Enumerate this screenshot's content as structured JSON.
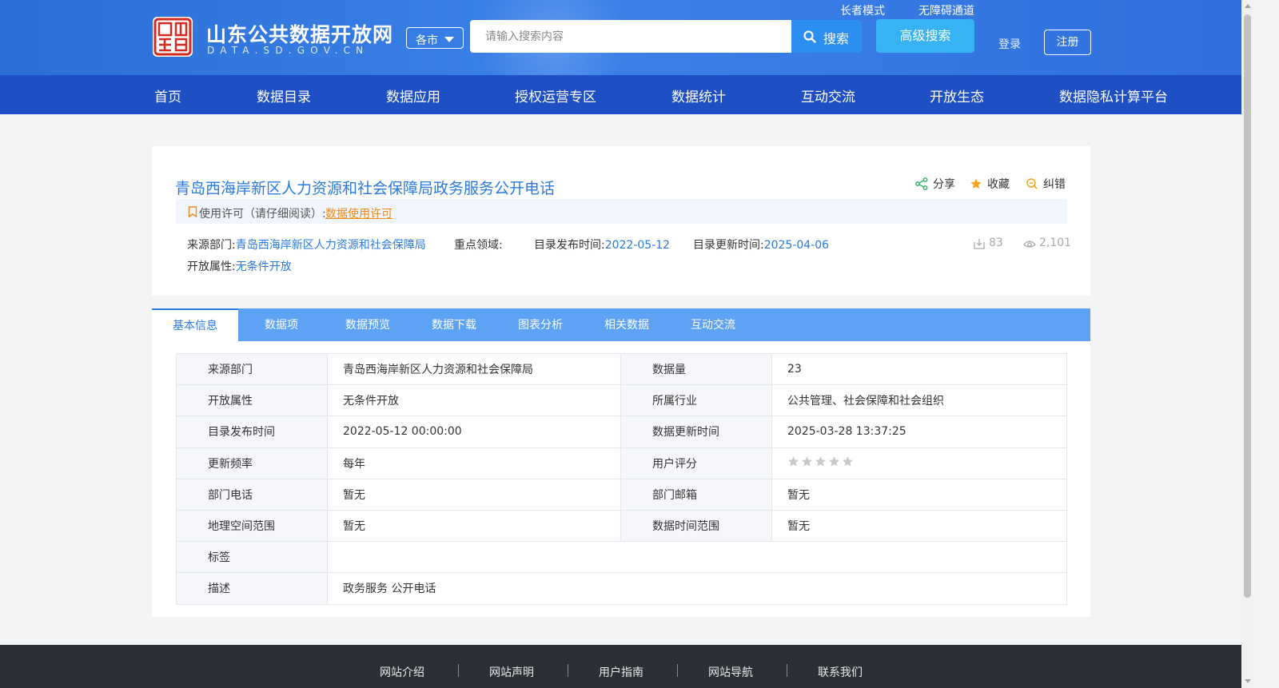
{
  "header": {
    "site_title": "山东公共数据开放网",
    "site_subtitle": "DATA.SD.GOV.CN",
    "city_select": "各市",
    "search_placeholder": "请输入搜索内容",
    "search_button": "搜索",
    "advanced_search": "高级搜索",
    "elder_mode": "长者模式",
    "accessibility": "无障碍通道",
    "login": "登录",
    "register": "注册"
  },
  "nav": {
    "items": [
      "首页",
      "数据目录",
      "数据应用",
      "授权运营专区",
      "数据统计",
      "互动交流",
      "开放生态",
      "数据隐私计算平台"
    ]
  },
  "dataset": {
    "title": "青岛西海岸新区人力资源和社会保障局政务服务公开电话",
    "actions": {
      "share": "分享",
      "favorite": "收藏",
      "report": "纠错"
    },
    "license_label": "使用许可（请仔细阅读）:",
    "license_link": "数据使用许可",
    "source_label": "来源部门:",
    "source_value": "青岛西海岸新区人力资源和社会保障局",
    "domain_label": "重点领域:",
    "domain_value": "",
    "publish_label": "目录发布时间:",
    "publish_value": "2022-05-12",
    "update_label": "目录更新时间:",
    "update_value": "2025-04-06",
    "open_label": "开放属性:",
    "open_value": "无条件开放",
    "downloads": "83",
    "views": "2,101"
  },
  "tabs": [
    "基本信息",
    "数据项",
    "数据预览",
    "数据下载",
    "图表分析",
    "相关数据",
    "互动交流"
  ],
  "info_table": {
    "rows": [
      {
        "k1": "来源部门",
        "v1": "青岛西海岸新区人力资源和社会保障局",
        "k2": "数据量",
        "v2": "23"
      },
      {
        "k1": "开放属性",
        "v1": "无条件开放",
        "k2": "所属行业",
        "v2": "公共管理、社会保障和社会组织"
      },
      {
        "k1": "目录发布时间",
        "v1": "2022-05-12 00:00:00",
        "k2": "数据更新时间",
        "v2": "2025-03-28 13:37:25"
      },
      {
        "k1": "更新频率",
        "v1": "每年",
        "k2": "用户评分",
        "v2": ""
      },
      {
        "k1": "部门电话",
        "v1": "暂无",
        "k2": "部门邮箱",
        "v2": "暂无"
      },
      {
        "k1": "地理空间范围",
        "v1": "暂无",
        "k2": "数据时间范围",
        "v2": "暂无"
      }
    ],
    "tags_label": "标签",
    "tags_value": "",
    "desc_label": "描述",
    "desc_value": "政务服务 公开电话",
    "rating_stars": 0,
    "rating_max": 5
  },
  "footer": {
    "links": [
      "网站介绍",
      "网站声明",
      "用户指南",
      "网站导航",
      "联系我们"
    ]
  },
  "colors": {
    "header_bg": "#2f74e0",
    "nav_bg": "#1e4fc4",
    "link_blue": "#2a7ae2",
    "license_orange": "#ef8a18",
    "tab_bar": "#5da2f5",
    "footer_bg": "#2c2f36"
  },
  "icons": {
    "logo": "shandong-seal-logo",
    "search": "search-icon",
    "share": "share-icon",
    "favorite": "star-icon",
    "report": "report-icon",
    "bookmark": "bookmark-icon",
    "download": "download-icon",
    "view": "eye-icon"
  }
}
